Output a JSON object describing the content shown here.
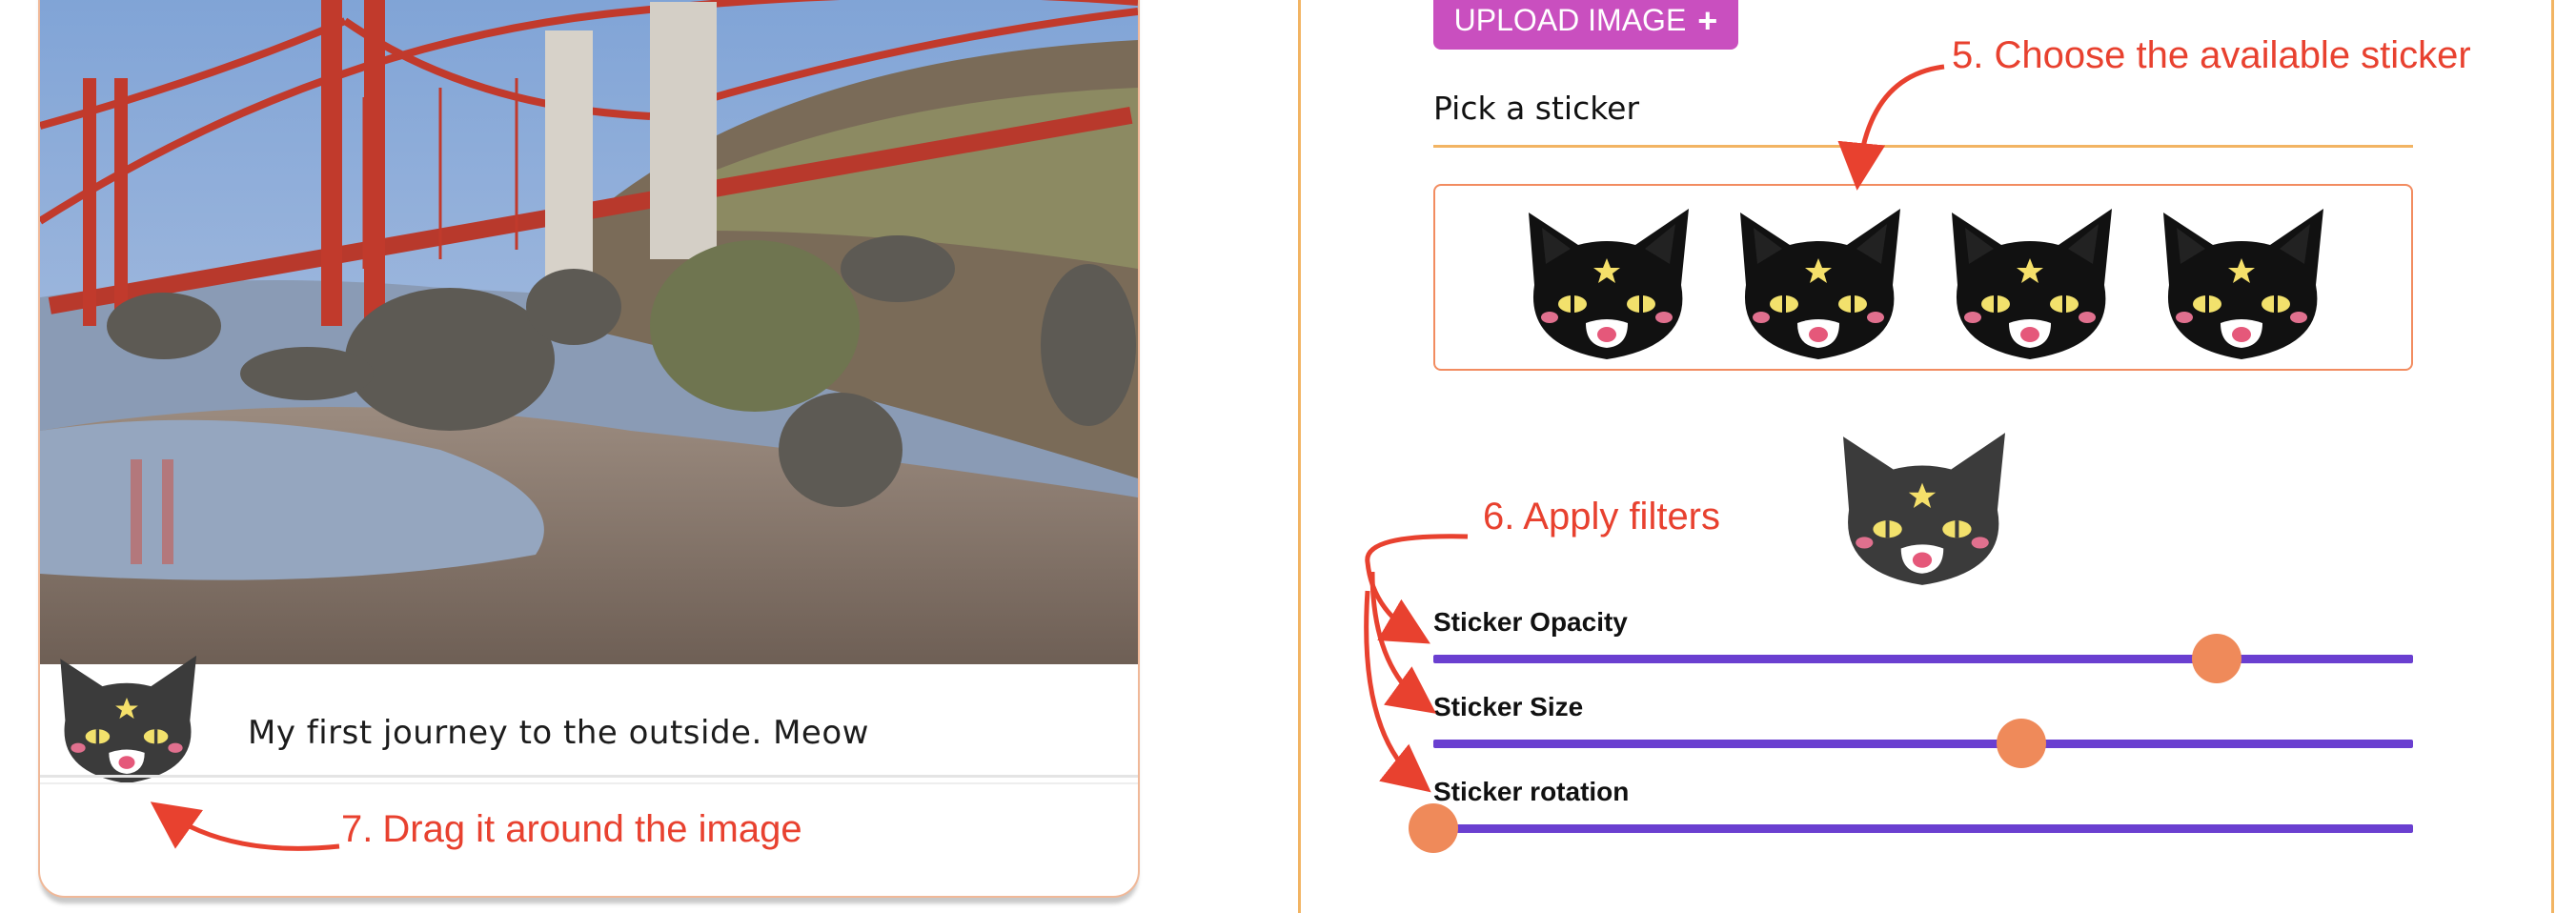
{
  "post": {
    "caption": "My first journey to the outside. Meow"
  },
  "annotations": {
    "choose_sticker": "5. Choose the available sticker",
    "apply_filters": "6. Apply filters",
    "drag_number": "7.",
    "drag_text": "Drag it around the image"
  },
  "upload": {
    "label": "UPLOAD IMAGE",
    "icon": "+"
  },
  "sticker_picker": {
    "label": "Pick a sticker",
    "stickers": [
      "cat-sticker-1",
      "cat-sticker-2",
      "cat-sticker-3",
      "cat-sticker-4"
    ]
  },
  "sliders": [
    {
      "label": "Sticker Opacity",
      "value": 0.8
    },
    {
      "label": "Sticker Size",
      "value": 0.6
    },
    {
      "label": "Sticker rotation",
      "value": 0.0
    }
  ],
  "colors": {
    "accent_button": "#c94fbf",
    "slider_track": "#6a3fd0",
    "slider_thumb": "#ef8a5a",
    "annotation": "#e8412f",
    "panel_border": "#f2b463"
  }
}
